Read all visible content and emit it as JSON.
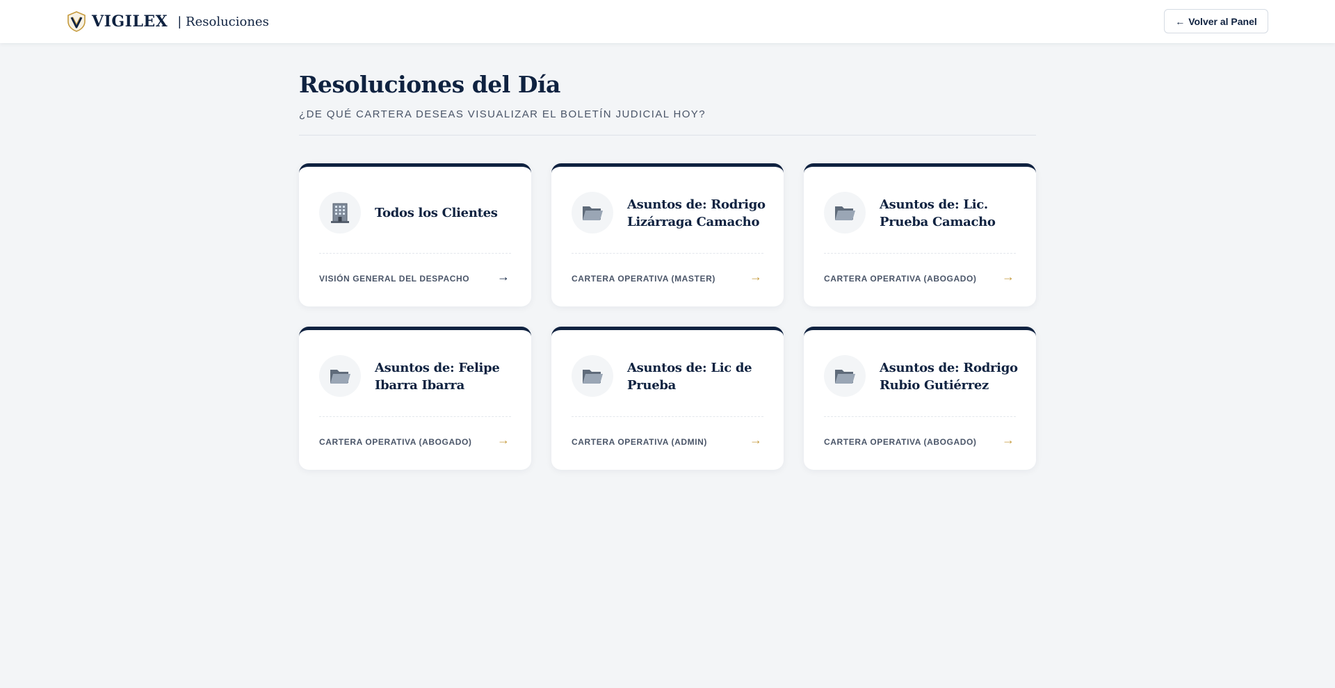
{
  "header": {
    "brand": "VIGILEX",
    "section": "| Resoluciones",
    "back_button": "Volver al Panel",
    "back_arrow": "←"
  },
  "page": {
    "title": "Resoluciones del Día",
    "subtitle": "¿DE QUÉ CARTERA DESEAS VISUALIZAR EL BOLETÍN JUDICIAL HOY?"
  },
  "colors": {
    "navy": "#0f2240",
    "gold": "#c59a3c",
    "background": "#f3f5f7"
  },
  "cards": [
    {
      "icon": "building-icon",
      "title": "Todos los Clientes",
      "footer": "VISIÓN GENERAL DEL DESPACHO",
      "arrow": "→"
    },
    {
      "icon": "folder-icon",
      "title": "Asuntos de: Rodrigo Lizárraga Camacho",
      "footer": "CARTERA OPERATIVA (MASTER)",
      "arrow": "→"
    },
    {
      "icon": "folder-icon",
      "title": "Asuntos de: Lic. Prueba Camacho",
      "footer": "CARTERA OPERATIVA (ABOGADO)",
      "arrow": "→"
    },
    {
      "icon": "folder-icon",
      "title": "Asuntos de: Felipe Ibarra Ibarra",
      "footer": "CARTERA OPERATIVA (ABOGADO)",
      "arrow": "→"
    },
    {
      "icon": "folder-icon",
      "title": "Asuntos de: Lic de Prueba",
      "footer": "CARTERA OPERATIVA (ADMIN)",
      "arrow": "→"
    },
    {
      "icon": "folder-icon",
      "title": "Asuntos de: Rodrigo Rubio Gutiérrez",
      "footer": "CARTERA OPERATIVA (ABOGADO)",
      "arrow": "→"
    }
  ]
}
